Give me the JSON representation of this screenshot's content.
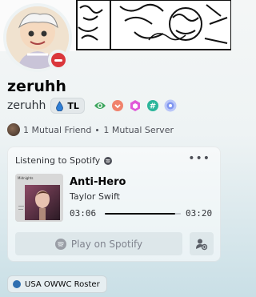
{
  "profile": {
    "display_name": "zeruhh",
    "username": "zeruhh",
    "tag": "TL",
    "status": "do-not-disturb",
    "badges": [
      "hypesquad-icon",
      "lootbox-icon",
      "nitro-gem-icon",
      "hashtag-icon",
      "server-boost-icon"
    ],
    "mutuals": {
      "friends": "1 Mutual Friend",
      "servers": "1 Mutual Server"
    }
  },
  "activity": {
    "header": "Listening to Spotify",
    "song_title": "Anti-Hero",
    "artist": "Taylor Swift",
    "album_label": "Midnights",
    "elapsed": "03:06",
    "duration": "03:20",
    "progress": 0.93,
    "play_label": "Play on Spotify"
  },
  "roles": [
    {
      "label": "USA OWWC Roster",
      "color": "#2f6fb0"
    }
  ],
  "colors": {
    "status_dnd": "#da373c",
    "accent_green": "#23a55a"
  }
}
